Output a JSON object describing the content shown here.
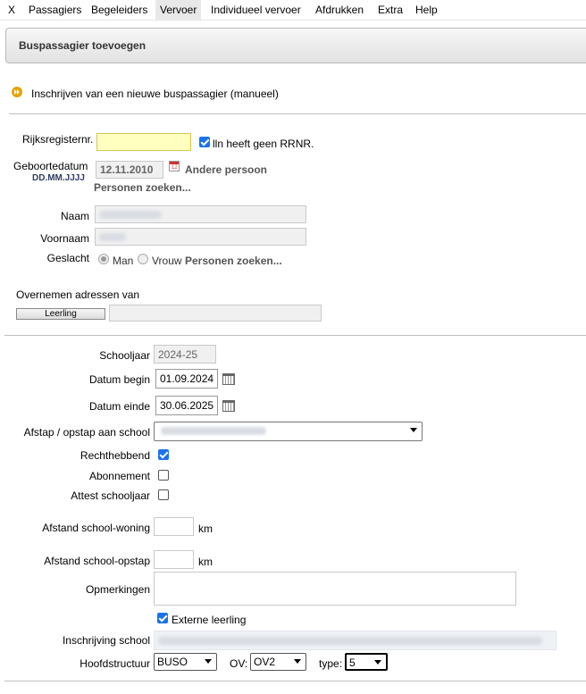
{
  "menu": [
    "X",
    "Passagiers",
    "Begeleiders",
    "Vervoer",
    "Individueel vervoer",
    "Afdrukken",
    "Extra",
    "Help"
  ],
  "header": {
    "title": "Buspassagier toevoegen"
  },
  "section": {
    "link": "Inschrijven van een nieuwe buspassagier (manueel)"
  },
  "person": {
    "rrn_label": "Rijksregisternr.",
    "rrn_value": "",
    "no_rrn_label": "lln heeft geen RRNR.",
    "no_rrn_checked": true,
    "birth_label": "Geboortedatum",
    "birth_format": "DD.MM.JJJJ",
    "birth_value": "12.11.2010",
    "other_person": "Andere persoon",
    "search_persons": "Personen zoeken...",
    "name_label": "Naam",
    "firstname_label": "Voornaam",
    "gender_label": "Geslacht",
    "gender_man": "Man",
    "gender_woman": "Vrouw",
    "gender_search": "Personen zoeken..."
  },
  "address": {
    "label": "Overnemen adressen van",
    "button": "Leerling"
  },
  "enrollment": {
    "schoolyear_label": "Schooljaar",
    "schoolyear_value": "2024-25",
    "start_label": "Datum begin",
    "start_value": "01.09.2024",
    "end_label": "Datum einde",
    "end_value": "30.06.2025",
    "stop_label": "Afstap / opstap aan school",
    "entitled_label": "Rechthebbend",
    "entitled_checked": true,
    "subscription_label": "Abonnement",
    "subscription_checked": false,
    "certificate_label": "Attest schooljaar",
    "certificate_checked": false,
    "distance_home_label": "Afstand school-woning",
    "distance_home_unit": "km",
    "distance_stop_label": "Afstand school-opstap",
    "distance_stop_unit": "km",
    "remarks_label": "Opmerkingen",
    "external_label": "Externe leerling",
    "external_checked": true,
    "school_label": "Inschrijving school",
    "structure_label": "Hoofdstructuur",
    "structure_value": "BUSO",
    "ov_label": "OV:",
    "ov_value": "OV2",
    "type_label": "type:",
    "type_value": "5"
  }
}
